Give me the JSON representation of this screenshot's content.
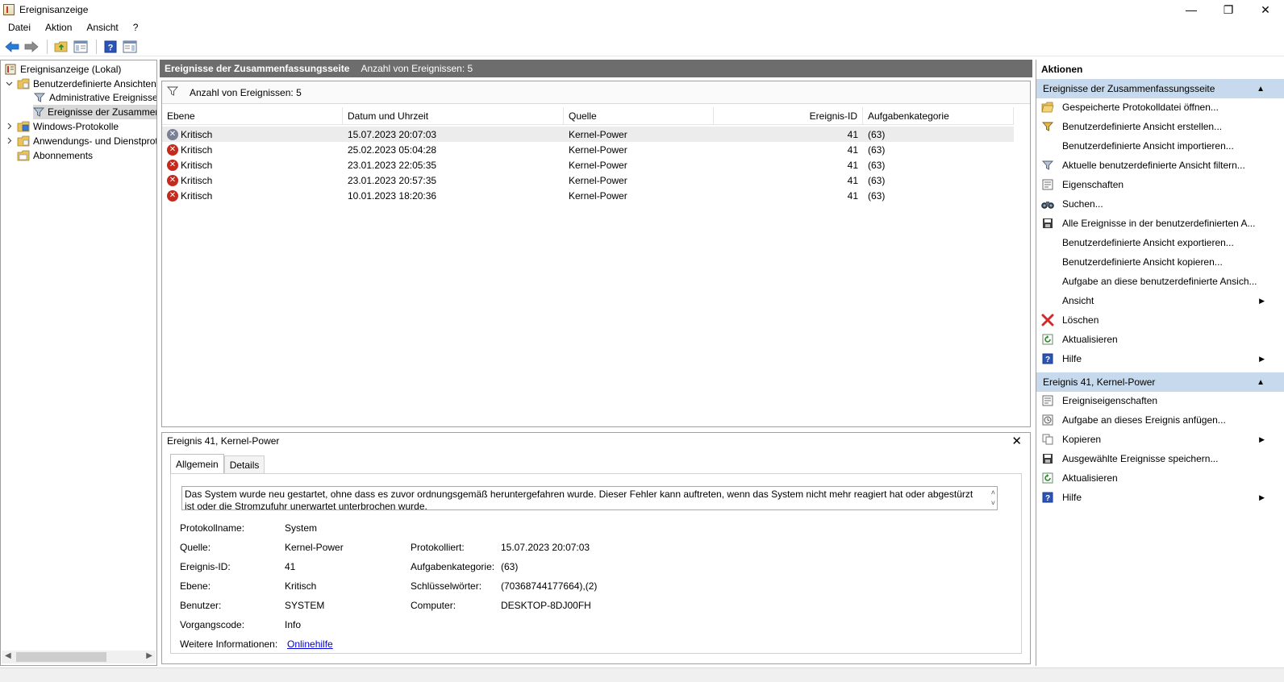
{
  "window": {
    "title": "Ereignisanzeige",
    "minimize": "—",
    "restore": "❐",
    "close": "✕"
  },
  "menu": [
    "Datei",
    "Aktion",
    "Ansicht",
    "?"
  ],
  "tree": {
    "root": "Ereignisanzeige (Lokal)",
    "custom_views": "Benutzerdefinierte Ansichten",
    "admin_events": "Administrative Ereignisse",
    "summary_events": "Ereignisse der Zusammenfassungsseite",
    "windows_logs": "Windows-Protokolle",
    "app_logs": "Anwendungs- und Dienstprotokolle",
    "subscriptions": "Abonnements"
  },
  "center": {
    "header_title": "Ereignisse der Zusammenfassungsseite",
    "header_count": "Anzahl von Ereignissen: 5",
    "filter_text": "Anzahl von Ereignissen: 5",
    "columns": [
      "Ebene",
      "Datum und Uhrzeit",
      "Quelle",
      "Ereignis-ID",
      "Aufgabenkategorie"
    ],
    "rows": [
      {
        "level": "Kritisch",
        "datetime": "15.07.2023 20:07:03",
        "source": "Kernel-Power",
        "id": "41",
        "category": "(63)"
      },
      {
        "level": "Kritisch",
        "datetime": "25.02.2023 05:04:28",
        "source": "Kernel-Power",
        "id": "41",
        "category": "(63)"
      },
      {
        "level": "Kritisch",
        "datetime": "23.01.2023 22:05:35",
        "source": "Kernel-Power",
        "id": "41",
        "category": "(63)"
      },
      {
        "level": "Kritisch",
        "datetime": "23.01.2023 20:57:35",
        "source": "Kernel-Power",
        "id": "41",
        "category": "(63)"
      },
      {
        "level": "Kritisch",
        "datetime": "10.01.2023 18:20:36",
        "source": "Kernel-Power",
        "id": "41",
        "category": "(63)"
      }
    ]
  },
  "details": {
    "title": "Ereignis 41, Kernel-Power",
    "close": "✕",
    "tabs": [
      "Allgemein",
      "Details"
    ],
    "description": "Das System wurde neu gestartet, ohne dass es zuvor ordnungsgemäß heruntergefahren wurde. Dieser Fehler kann auftreten, wenn das System nicht mehr reagiert hat oder abgestürzt ist oder die Stromzufuhr unerwartet unterbrochen wurde.",
    "log_name_label": "Protokollname:",
    "log_name": "System",
    "source_label": "Quelle:",
    "source": "Kernel-Power",
    "logged_label": "Protokolliert:",
    "logged": "15.07.2023 20:07:03",
    "event_id_label": "Ereignis-ID:",
    "event_id": "41",
    "task_cat_label": "Aufgabenkategorie:",
    "task_cat": "(63)",
    "level_label": "Ebene:",
    "level": "Kritisch",
    "keywords_label": "Schlüsselwörter:",
    "keywords": "(70368744177664),(2)",
    "user_label": "Benutzer:",
    "user": "SYSTEM",
    "computer_label": "Computer:",
    "computer": "DESKTOP-8DJ00FH",
    "opcode_label": "Vorgangscode:",
    "opcode": "Info",
    "more_info_label": "Weitere Informationen:",
    "more_info_link": "Onlinehilfe"
  },
  "actions": {
    "header": "Aktionen",
    "section1": "Ereignisse der Zusammenfassungsseite",
    "items1": [
      "Gespeicherte Protokolldatei öffnen...",
      "Benutzerdefinierte Ansicht erstellen...",
      "Benutzerdefinierte Ansicht importieren...",
      "Aktuelle benutzerdefinierte Ansicht filtern...",
      "Eigenschaften",
      "Suchen...",
      "Alle Ereignisse in der benutzerdefinierten A...",
      "Benutzerdefinierte Ansicht exportieren...",
      "Benutzerdefinierte Ansicht kopieren...",
      "Aufgabe an diese benutzerdefinierte Ansich...",
      "Ansicht",
      "Löschen",
      "Aktualisieren",
      "Hilfe"
    ],
    "section2": "Ereignis 41, Kernel-Power",
    "items2": [
      "Ereigniseigenschaften",
      "Aufgabe an dieses Ereignis anfügen...",
      "Kopieren",
      "Ausgewählte Ereignisse speichern...",
      "Aktualisieren",
      "Hilfe"
    ]
  }
}
